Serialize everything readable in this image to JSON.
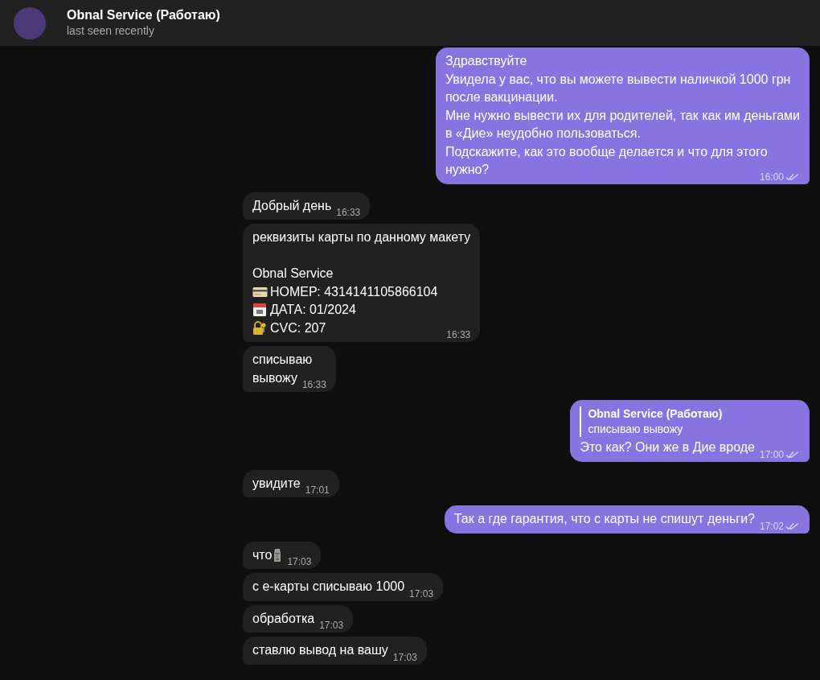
{
  "header": {
    "title": "Obnal Service (Работаю)",
    "status": "last seen recently"
  },
  "messages": [
    {
      "kind": "out",
      "lines": [
        {
          "kind": "text",
          "text": "Здравствуйте"
        },
        {
          "kind": "text",
          "text": "Увидела у вас, что вы можете вывести наличкой 1000 грн"
        },
        {
          "kind": "text",
          "text": "после вакцинации."
        },
        {
          "kind": "text",
          "text": "Мне нужно вывести их для родителей, так как им деньгами"
        },
        {
          "kind": "text",
          "text": "в «Дие» неудобно пользоваться."
        },
        {
          "kind": "text",
          "text": "Подскажите, как это вообще делается и что для этого"
        },
        {
          "kind": "text",
          "text": "нужно?"
        }
      ],
      "time": "16:00",
      "read": true
    },
    {
      "kind": "in",
      "lines": [
        {
          "kind": "text",
          "text": "Добрый день"
        }
      ],
      "time": "16:33"
    },
    {
      "kind": "in",
      "lines": [
        {
          "kind": "text",
          "text": "реквизиты карты по данному макету"
        },
        {
          "kind": "blank"
        },
        {
          "kind": "text",
          "text": "Obnal Service"
        },
        {
          "kind": "card",
          "text": "НОМЕР: 4314141105866104"
        },
        {
          "kind": "calendar",
          "text": "ДАТА: 01/2024"
        },
        {
          "kind": "lock",
          "text": "CVC: 207"
        }
      ],
      "time": "16:33"
    },
    {
      "kind": "in",
      "lines": [
        {
          "kind": "text",
          "text": "списываю"
        },
        {
          "kind": "text",
          "text": "вывожу"
        }
      ],
      "time": "16:33"
    },
    {
      "kind": "out",
      "reply": {
        "author": "Obnal Service (Работаю)",
        "text": "списываю вывожу"
      },
      "lines": [
        {
          "kind": "text",
          "text": "Это как? Они же в Дие вроде"
        }
      ],
      "time": "17:00",
      "read": true
    },
    {
      "kind": "in",
      "lines": [
        {
          "kind": "text",
          "text": "увидите"
        }
      ],
      "time": "17:01"
    },
    {
      "kind": "out",
      "lines": [
        {
          "kind": "text",
          "text": "Так а где гарантия, что с карты не спишут деньги?"
        }
      ],
      "time": "17:02",
      "read": true
    },
    {
      "kind": "in",
      "lines": [
        {
          "kind": "moai",
          "text": "что"
        }
      ],
      "time": "17:03"
    },
    {
      "kind": "in",
      "lines": [
        {
          "kind": "text",
          "text": "с е-карты списываю 1000"
        }
      ],
      "time": "17:03"
    },
    {
      "kind": "in",
      "lines": [
        {
          "kind": "text",
          "text": "обработка"
        }
      ],
      "time": "17:03"
    },
    {
      "kind": "in",
      "lines": [
        {
          "kind": "text",
          "text": "ставлю вывод на вашу"
        }
      ],
      "time": "17:03"
    }
  ]
}
